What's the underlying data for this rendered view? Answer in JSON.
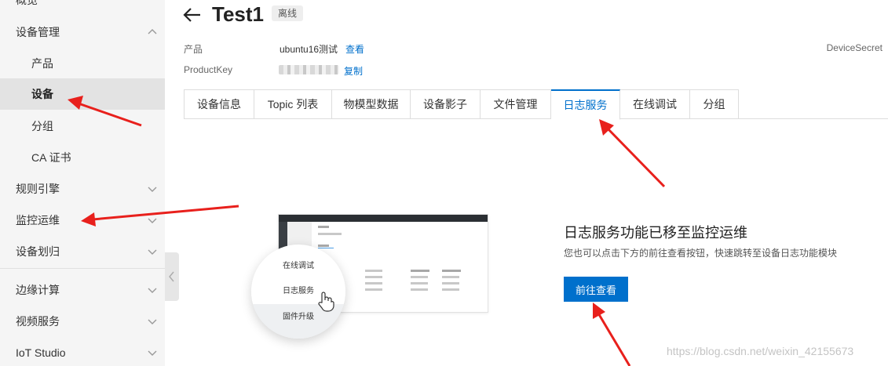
{
  "sidebar": {
    "items": [
      {
        "label": "概览"
      },
      {
        "label": "设备管理"
      },
      {
        "label": "产品"
      },
      {
        "label": "设备"
      },
      {
        "label": "分组"
      },
      {
        "label": "CA 证书"
      },
      {
        "label": "规则引擎"
      },
      {
        "label": "监控运维"
      },
      {
        "label": "设备划归"
      },
      {
        "label": "边缘计算"
      },
      {
        "label": "视频服务"
      },
      {
        "label": "IoT Studio"
      }
    ]
  },
  "header": {
    "title": "Test1",
    "status_badge": "离线"
  },
  "meta": {
    "product_label": "产品",
    "product_value": "ubuntu16测试",
    "product_link": "查看",
    "productkey_label": "ProductKey",
    "productkey_link": "复制",
    "devicesecret_label": "DeviceSecret"
  },
  "tabs": [
    {
      "label": "设备信息"
    },
    {
      "label": "Topic 列表"
    },
    {
      "label": "物模型数据"
    },
    {
      "label": "设备影子"
    },
    {
      "label": "文件管理"
    },
    {
      "label": "日志服务"
    },
    {
      "label": "在线调试"
    },
    {
      "label": "分组"
    }
  ],
  "illustration": {
    "menu": [
      "在线调试",
      "日志服务",
      "固件升级"
    ]
  },
  "panel": {
    "title": "日志服务功能已移至监控运维",
    "description": "您也可以点击下方的前往查看按钮，快速跳转至设备日志功能模块",
    "button": "前往查看"
  },
  "watermark": "https://blog.csdn.net/weixin_42155673",
  "colors": {
    "accent": "#0070cc",
    "annotation_arrow": "#e8201c",
    "sidebar_bg": "#f5f5f5"
  }
}
